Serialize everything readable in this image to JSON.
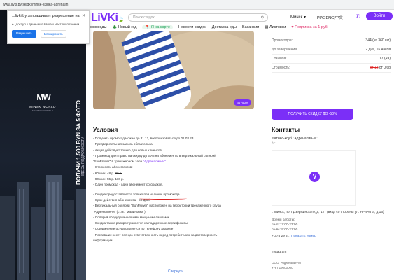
{
  "browser": {
    "url": "www.livki.by/skidki/minsk-skidka-adrenalin",
    "nav_icons": [
      "back-icon",
      "forward-icon",
      "reload-icon"
    ]
  },
  "permission_popup": {
    "title": "...livki.by запрашивает разрешение на",
    "desc": "доступ к данным о вашем местоположении",
    "allow": "Разрешить",
    "deny": "Блокировать"
  },
  "ad": {
    "logo": "MW",
    "logo_title": "MINSK WORLD",
    "logo_sub": "MY CITY. MY WORLD",
    "vertical_main": "ПОЛУЧИ 1.500 BYN ЗА 5 ФОТО",
    "vertical_sub": "ЗДЕСЬ ПОДРОБНОСТИ"
  },
  "header": {
    "brand": "LiVKi",
    "search_placeholder": "Поиск скидок",
    "city": "Минск",
    "lang": "РУС|ENG|中文",
    "login": "Войти",
    "nav": [
      "Промокоды",
      "Новый год",
      "Я на карте",
      "Новости скидок",
      "Доставка еды",
      "Вакансии",
      "Листовки",
      "Подписка за 1 руб"
    ]
  },
  "image": {
    "badge": "до -50%"
  },
  "stats": [
    {
      "label": "Промокодов:",
      "value": "344 (из 360 шт)"
    },
    {
      "label": "До завершения:",
      "value": "2 дня, 16 часов"
    },
    {
      "label": "Отзывов:",
      "value": "17 (+9)"
    },
    {
      "label": "Стоимость:",
      "value_old": "от 1р",
      "value": "от 0,6р"
    }
  ],
  "get_button": "ПОЛУЧИТЬ СКИДКУ ДО -50%",
  "conditions": {
    "title": "Условия",
    "lines_a": [
      "- Получить промокод можно до 31.12, воспользоваться до 01.03.23",
      "- Предварительная запись обязательна",
      "- Акция действует только для новых клиентов",
      "- Промокод дает право на скидку до 50% на абонементы в вертикальный солярий"
    ],
    "sunflower": "\"SunFlower\" в тренажерном зале ",
    "sunflower_link": "\"Адреналин-М\"",
    "price_header": "- Стоимость абонементов:",
    "price_60": "- 60 мин: 48 р. ",
    "price_60_old": "80 р.",
    "price_90": "- 90 мин: 55 р. ",
    "price_90_old": "110 р.",
    "one_per": "- Один промокод - один абонемент со скидкой.",
    "lines_b": [
      "- Скидка предоставляется только при наличии промокода.",
      "- Срок действия абонемента - 90 дней",
      "- Вертикальный солярий \"SunFlower\" расположен на территории тренажерного клуба",
      "\"Адреналин-М\" (ст.м. \"Малиновка\")",
      "- Солярий оборудован новыми мощными лампами",
      "- Скидка также распространяется на подарочные сертификаты",
      "- Оформление осуществляется по телефону заранее",
      "- Поставщик несет полную ответственность перед потребителем за достоверность",
      "информации."
    ],
    "collapse": "Свернуть"
  },
  "contacts": {
    "title": "Контакты",
    "name": "Фитнес-клуб \"Адреналин-М\"",
    "small": "+/-",
    "address": "г. Минск, пр-т Дзержинского, д. 127 (вход со стороны ул. Я.Чечота, д.16)",
    "hours_title": "Время работы:",
    "hours_1": "пн-пт: 7:00-23:00",
    "hours_2": "сб-вс: 9:00-21:00",
    "phone": "+ 375 29 2... ",
    "phone_show": "Показать номер",
    "instagram": "Instagram",
    "org": "ООО \"Адреналин-М\"",
    "org2": "УНП 19000000"
  },
  "colors": {
    "brand": "#7b2ff7",
    "accent_green": "#1fc46b",
    "danger": "#d22"
  }
}
